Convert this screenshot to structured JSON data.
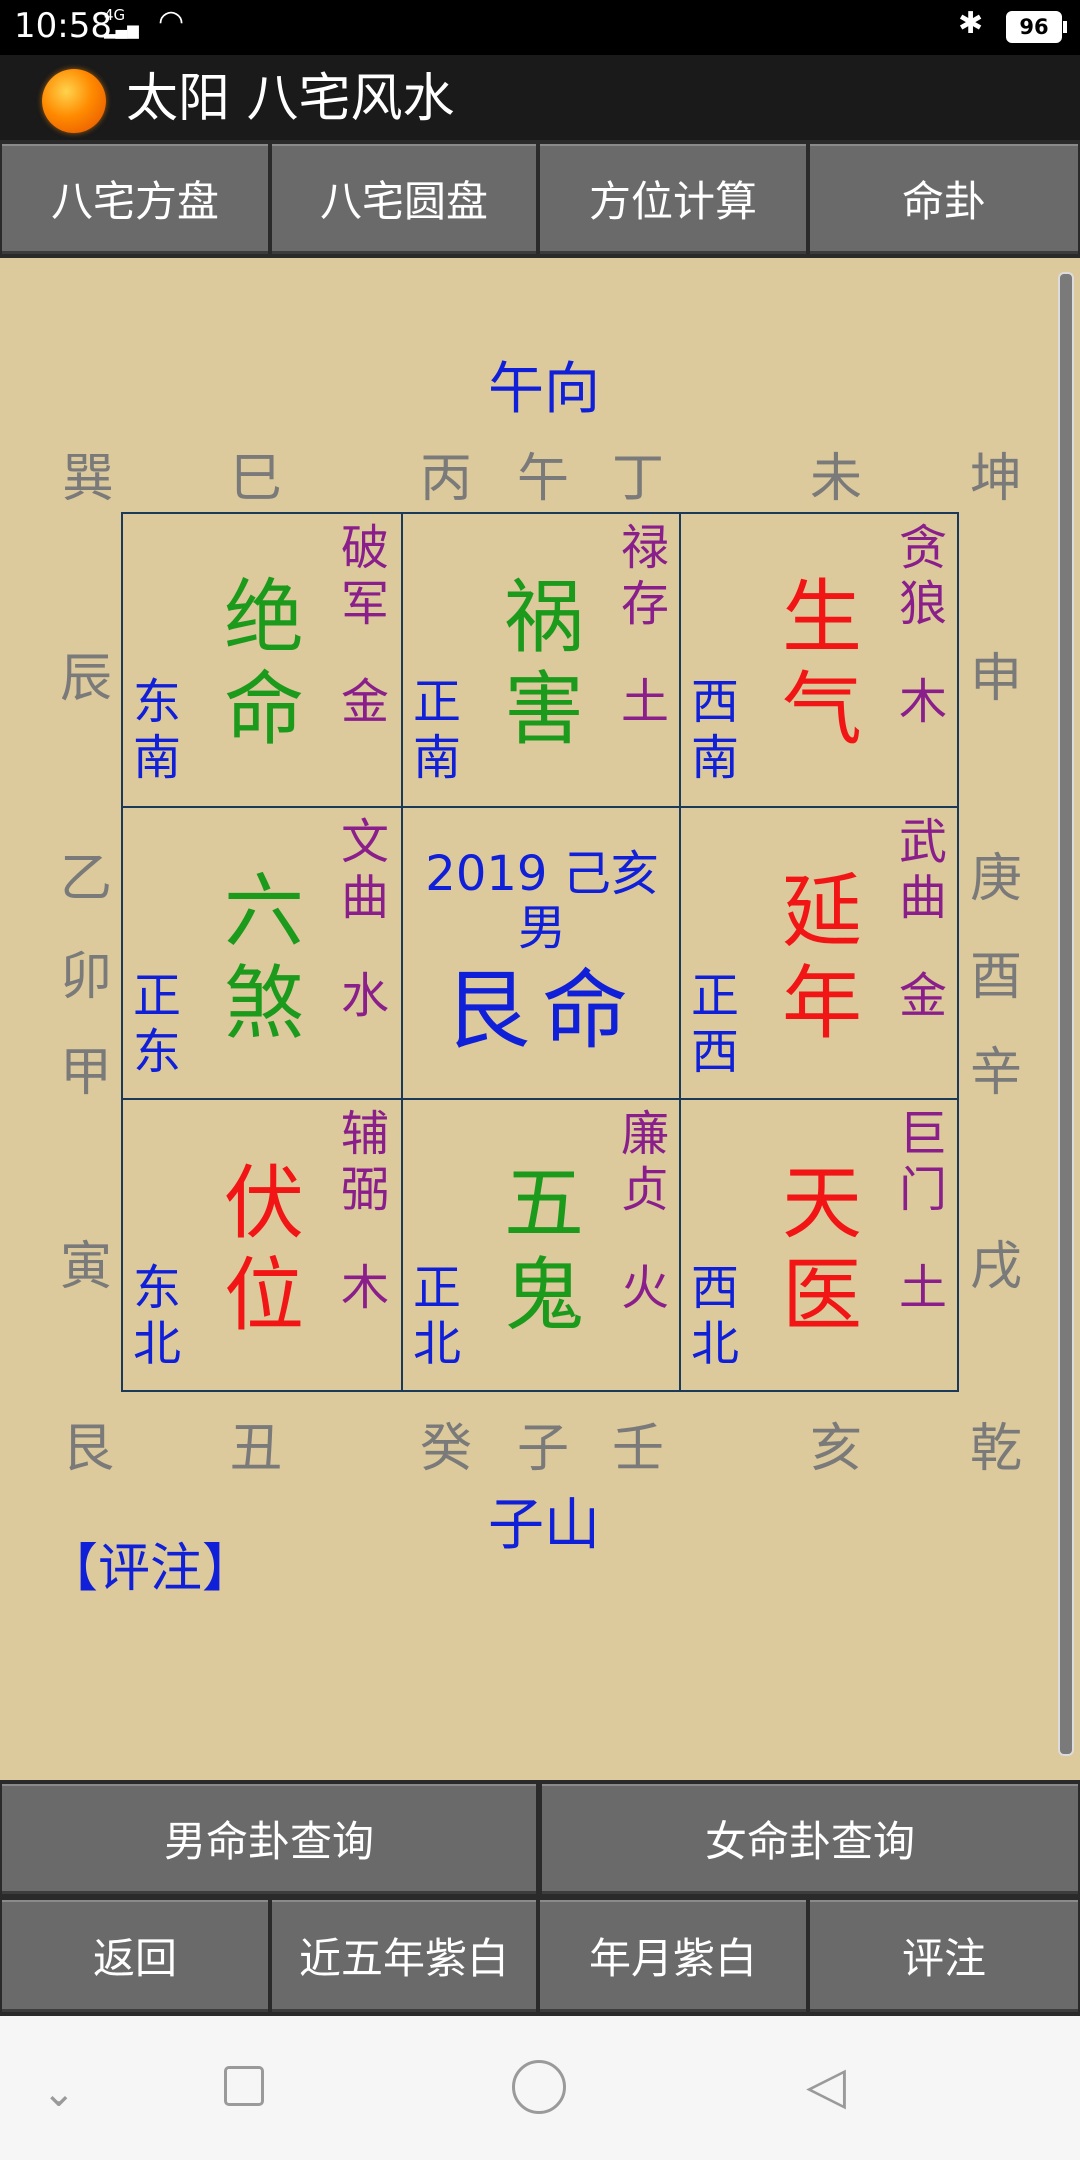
{
  "status": {
    "time": "10:58",
    "signal": "4G",
    "battery": "96",
    "wifi_icon": "wifi-icon",
    "bluetooth_icon": "bluetooth-icon"
  },
  "app": {
    "title": "太阳 八宅风水"
  },
  "tabs": [
    "八宅方盘",
    "八宅圆盘",
    "方位计算",
    "命卦"
  ],
  "chart": {
    "top_label": "午向",
    "bottom_label": "子山",
    "top_row": [
      "巽",
      "巳",
      "丙",
      "午",
      "丁",
      "未",
      "坤"
    ],
    "bottom_row": [
      "艮",
      "丑",
      "癸",
      "子",
      "壬",
      "亥",
      "乾"
    ],
    "left_col": [
      "辰",
      "乙",
      "卯",
      "甲",
      "寅"
    ],
    "right_col": [
      "申",
      "庚",
      "酉",
      "辛",
      "戌"
    ],
    "cells": {
      "tl": {
        "gua": "绝命",
        "star": "破军",
        "element": "金",
        "direction": "东南"
      },
      "tc": {
        "gua": "祸害",
        "star": "禄存",
        "element": "土",
        "direction": "正南"
      },
      "tr": {
        "gua": "生气",
        "star": "贪狼",
        "element": "木",
        "direction": "西南"
      },
      "ml": {
        "gua": "六煞",
        "star": "文曲",
        "element": "水",
        "direction": "正东"
      },
      "center": {
        "year": "2019 己亥",
        "gender": "男",
        "ming": "艮命"
      },
      "mr": {
        "gua": "延年",
        "star": "武曲",
        "element": "金",
        "direction": "正西"
      },
      "bl": {
        "gua": "伏位",
        "star": "辅弼",
        "element": "木",
        "direction": "东北"
      },
      "bc": {
        "gua": "五鬼",
        "star": "廉贞",
        "element": "火",
        "direction": "正北"
      },
      "br": {
        "gua": "天医",
        "star": "巨门",
        "element": "土",
        "direction": "西北"
      }
    },
    "colors": {
      "lucky": "#f21515",
      "unlucky": "#1c9a1c",
      "star": "#8a1f8c",
      "direction": "#1020d8"
    }
  },
  "comment_label": "【评注】",
  "buttons_row1": [
    "男命卦查询",
    "女命卦查询"
  ],
  "buttons_row2": [
    "返回",
    "近五年紫白",
    "年月紫白",
    "评注"
  ]
}
